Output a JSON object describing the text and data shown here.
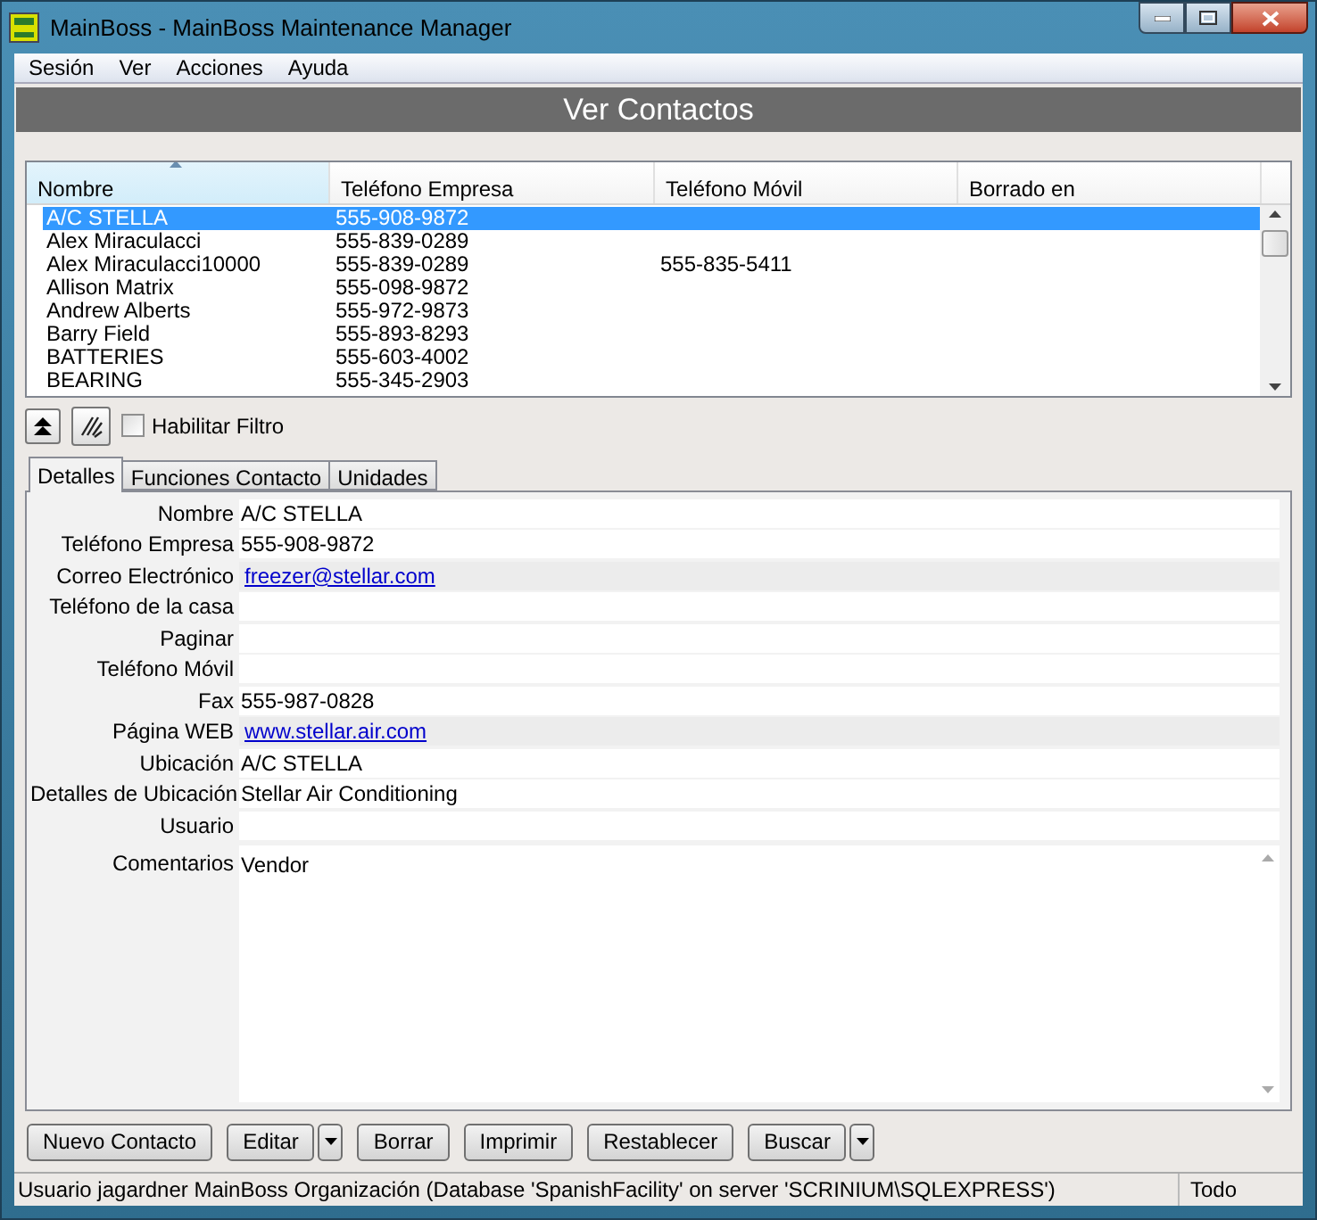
{
  "window": {
    "title": "MainBoss - MainBoss Maintenance Manager"
  },
  "menu": [
    "Sesión",
    "Ver",
    "Acciones",
    "Ayuda"
  ],
  "header": "Ver Contactos",
  "table": {
    "columns": [
      {
        "label": "Nombre",
        "sorted": true
      },
      {
        "label": "Teléfono Empresa",
        "sorted": false
      },
      {
        "label": "Teléfono Móvil",
        "sorted": false
      },
      {
        "label": "Borrado en",
        "sorted": false
      }
    ],
    "rows": [
      {
        "cells": [
          "A/C STELLA",
          "555-908-9872",
          ""
        ],
        "selected": true
      },
      {
        "cells": [
          "Alex Miraculacci",
          "555-839-0289",
          ""
        ],
        "selected": false
      },
      {
        "cells": [
          "Alex Miraculacci10000",
          "555-839-0289",
          "555-835-5411"
        ],
        "selected": false
      },
      {
        "cells": [
          "Allison Matrix",
          "555-098-9872",
          ""
        ],
        "selected": false
      },
      {
        "cells": [
          "Andrew Alberts",
          "555-972-9873",
          ""
        ],
        "selected": false
      },
      {
        "cells": [
          "Barry Field",
          "555-893-8293",
          ""
        ],
        "selected": false
      },
      {
        "cells": [
          "BATTERIES",
          "555-603-4002",
          ""
        ],
        "selected": false
      },
      {
        "cells": [
          "BEARING",
          "555-345-2903",
          ""
        ],
        "selected": false
      }
    ]
  },
  "filter": {
    "label": "Habilitar Filtro",
    "checked": false
  },
  "tabs": [
    {
      "label": "Detalles",
      "selected": true
    },
    {
      "label": "Funciones Contacto",
      "selected": false
    },
    {
      "label": "Unidades",
      "selected": false
    }
  ],
  "fields": [
    {
      "label": "Nombre",
      "value": "A/C STELLA",
      "kind": "text"
    },
    {
      "label": "Teléfono Empresa",
      "value": "555-908-9872",
      "kind": "text"
    },
    {
      "label": "Correo Electrónico",
      "value": "freezer@stellar.com",
      "kind": "link"
    },
    {
      "label": "Teléfono de la casa",
      "kind": "text"
    },
    {
      "label": "Paginar",
      "kind": "text"
    },
    {
      "label": "Teléfono Móvil",
      "kind": "text"
    },
    {
      "label": "Fax",
      "value": "555-987-0828",
      "kind": "text"
    },
    {
      "label": "Página WEB",
      "value": "www.stellar.air.com",
      "kind": "link"
    },
    {
      "label": "Ubicación",
      "value": "A/C STELLA",
      "kind": "text"
    },
    {
      "label": "Detalles de Ubicación",
      "value": "Stellar Air Conditioning",
      "kind": "text"
    },
    {
      "label": "Usuario",
      "kind": "text"
    },
    {
      "label": "Comentarios",
      "value": "Vendor",
      "kind": "multiline"
    }
  ],
  "buttons": [
    {
      "label": "Nuevo Contacto",
      "kind": "button"
    },
    {
      "label": "Editar",
      "kind": "button"
    },
    {
      "kind": "dropdown"
    },
    {
      "label": "Borrar",
      "kind": "button"
    },
    {
      "label": "Imprimir",
      "kind": "button"
    },
    {
      "label": "Restablecer",
      "kind": "button"
    },
    {
      "label": "Buscar",
      "kind": "button"
    },
    {
      "kind": "dropdown"
    }
  ],
  "status_bar": {
    "message": "Usuario jagardner MainBoss Organización (Database 'SpanishFacility' on server 'SCRINIUM\\SQLEXPRESS')",
    "mode": "Todo"
  }
}
